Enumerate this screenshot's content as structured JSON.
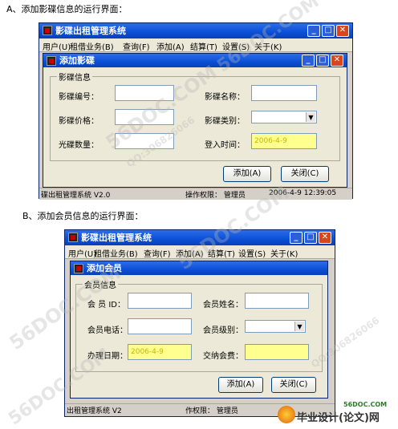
{
  "captions": {
    "a": "A、添加影碟信息的运行界面：",
    "b": "B、添加会员信息的运行界面："
  },
  "window1": {
    "title": "影碟出租管理系统",
    "menu": [
      "用户(U)",
      "租借业务(B)",
      "查询(F)",
      "添加(A)",
      "结算(T)",
      "设置(S)",
      "关于(K)"
    ],
    "dialog": {
      "title": "添加影碟",
      "group_label": "影碟信息",
      "fields": {
        "disc_id_label": "影碟编号：",
        "disc_name_label": "影碟名称：",
        "disc_price_label": "影碟价格：",
        "disc_type_label": "影碟类别：",
        "disc_count_label": "光碟数量：",
        "register_time_label": "登入时间：",
        "register_time_value": "2006-4-9"
      },
      "add_button": "添加(A)",
      "close_button": "关闭(C)"
    },
    "status": {
      "app": "碟出租管理系统  V2.0",
      "permission": "操作权限：  管理员",
      "datetime": "2006-4-9 12:39:05"
    }
  },
  "window2": {
    "title": "影碟出租管理系统",
    "menu": [
      "用户(U)",
      "租借业务(B)",
      "查询(F)",
      "添加(A)",
      "结算(T)",
      "设置(S)",
      "关于(K)"
    ],
    "dialog": {
      "title": "添加会员",
      "group_label": "会员信息",
      "fields": {
        "member_id_label": "会 员 ID：",
        "member_name_label": "会员姓名：",
        "member_phone_label": "会员电话：",
        "member_level_label": "会员级别：",
        "join_date_label": "办理日期：",
        "join_date_value": "2006-4-9",
        "fee_label": "交纳会费："
      },
      "add_button": "添加(A)",
      "close_button": "关闭(C)"
    },
    "status": {
      "app": "出租管理系统  V2",
      "permission": "作权限：  管理员"
    }
  },
  "watermarks": {
    "site": "56DOC.COM",
    "qq": "QQ:306826066"
  },
  "logo": {
    "site": "56DOC.COM",
    "text": "毕业设计(论文)网"
  }
}
